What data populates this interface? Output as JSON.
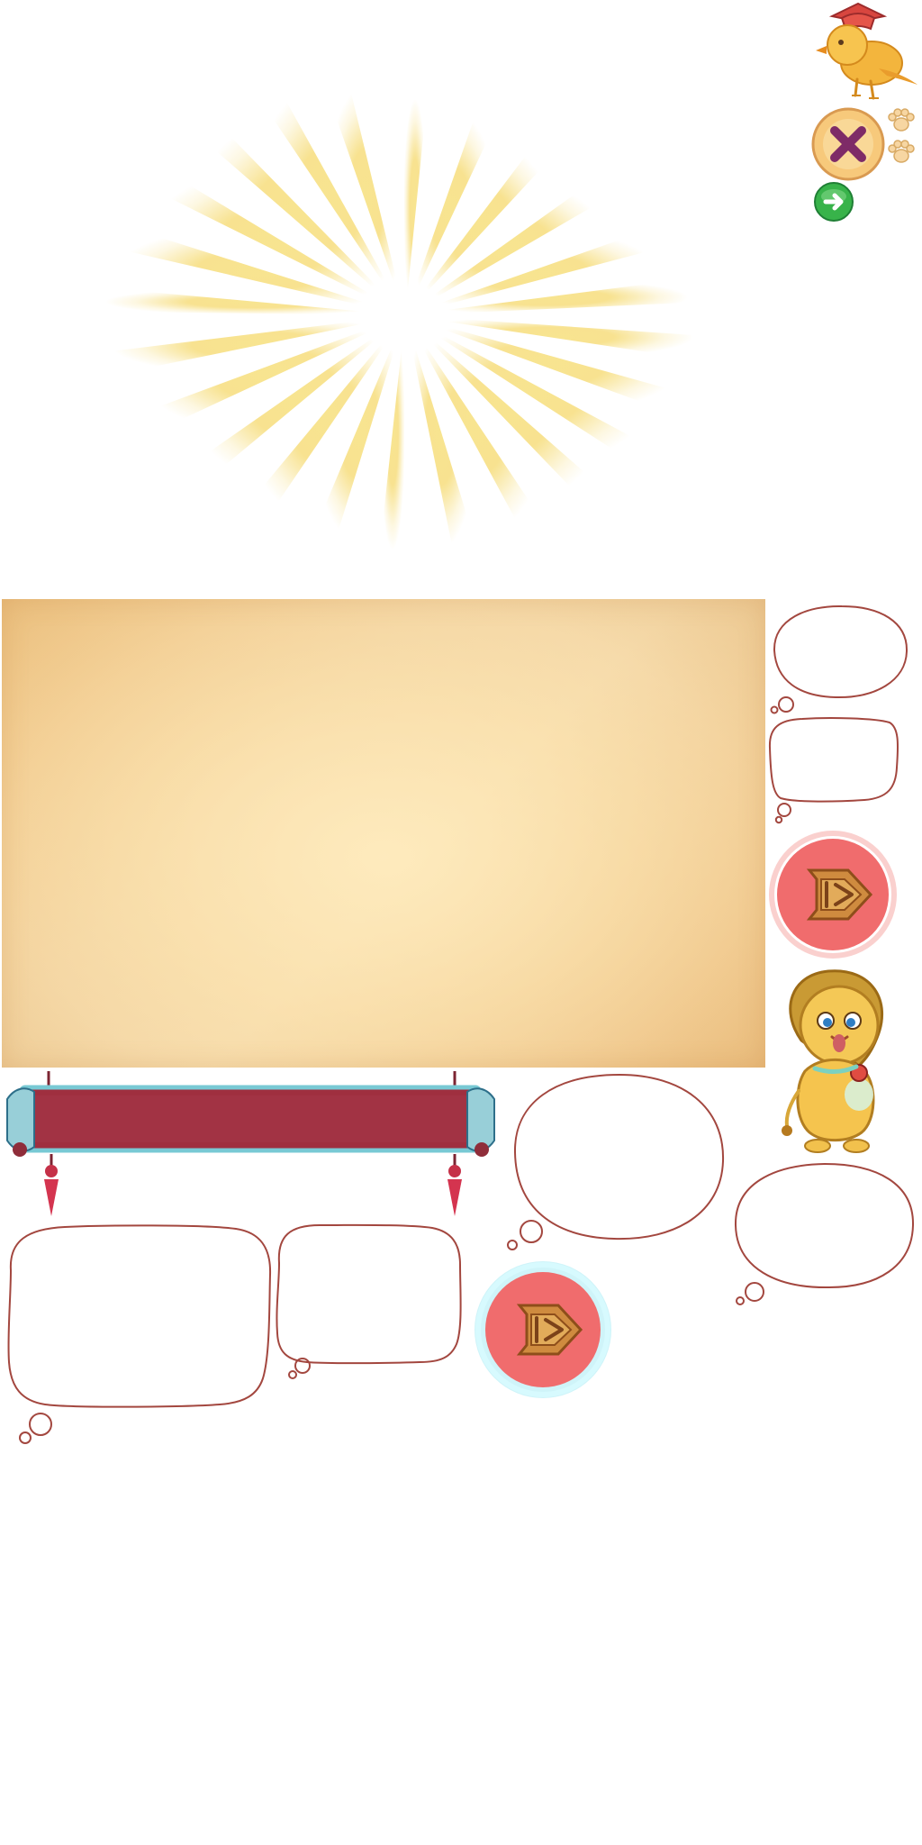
{
  "assets": [
    "sunburst",
    "bird-mascot",
    "close-button",
    "paw-icon",
    "paw-icon",
    "green-arrow-button",
    "parchment-panel",
    "thought-bubble",
    "thought-bubble",
    "play-button",
    "lion-mascot",
    "scroll-banner",
    "thought-bubble",
    "thought-bubble",
    "speech-bubble",
    "speech-bubble",
    "play-button-glow"
  ],
  "colors": {
    "sunburst": "#f6dc78",
    "parchment": "#f5d59f",
    "bubble_outline": "#a3473f",
    "banner_red": "#9f2f3f",
    "banner_trim": "#78c9d4",
    "play_button": "#f06c6d",
    "play_button_gold": "#cf8b3f",
    "close_button_bg": "#f7c97b",
    "close_button_x": "#7e2b67",
    "arrow_button": "#38b34a",
    "lion_fur": "#f0c24b",
    "bird_body": "#f3b53d",
    "bird_hat": "#e5554a"
  }
}
